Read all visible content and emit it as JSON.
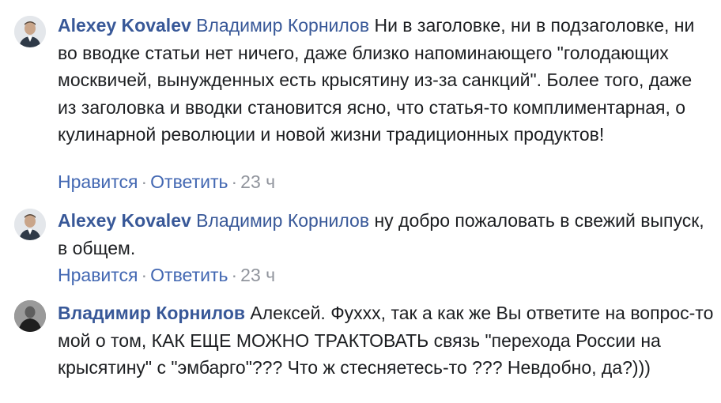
{
  "comments": [
    {
      "author": "Alexey Kovalev",
      "mention": "Владимир Корнилов",
      "text": "Ни в заголовке, ни в подзаголовке, ни во вводке статьи нет ничего, даже близко напоминающего \"голодающих москвичей, вынужденных есть крысятину из-за санкций\". Более того, даже из заголовка и вводки становится ясно, что статья-то комплиментарная, о кулинарной революции и новой жизни традиционных продуктов!",
      "like_label": "Нравится",
      "reply_label": "Ответить",
      "time": "23 ч",
      "separator": "·"
    },
    {
      "author": "Alexey Kovalev",
      "mention": "Владимир Корнилов",
      "text": "ну добро пожаловать в свежий выпуск, в общем.",
      "like_label": "Нравится",
      "reply_label": "Ответить",
      "time": "23 ч",
      "separator": "·"
    },
    {
      "author": "Владимир Корнилов",
      "text": "Алексей. Фуххх, так а как же Вы ответите на вопрос-то мой о том, КАК ЕЩЕ МОЖНО ТРАКТОВАТЬ связь \"перехода России на крысятину\" с \"эмбарго\"??? Что ж стесняетесь-то ??? Невдобно, да?)))"
    }
  ],
  "colors": {
    "link": "#385898",
    "action": "#4267b2",
    "meta": "#90949c",
    "text": "#1c1e21"
  },
  "icons": [
    "avatar-alexey",
    "avatar-vladimir"
  ]
}
